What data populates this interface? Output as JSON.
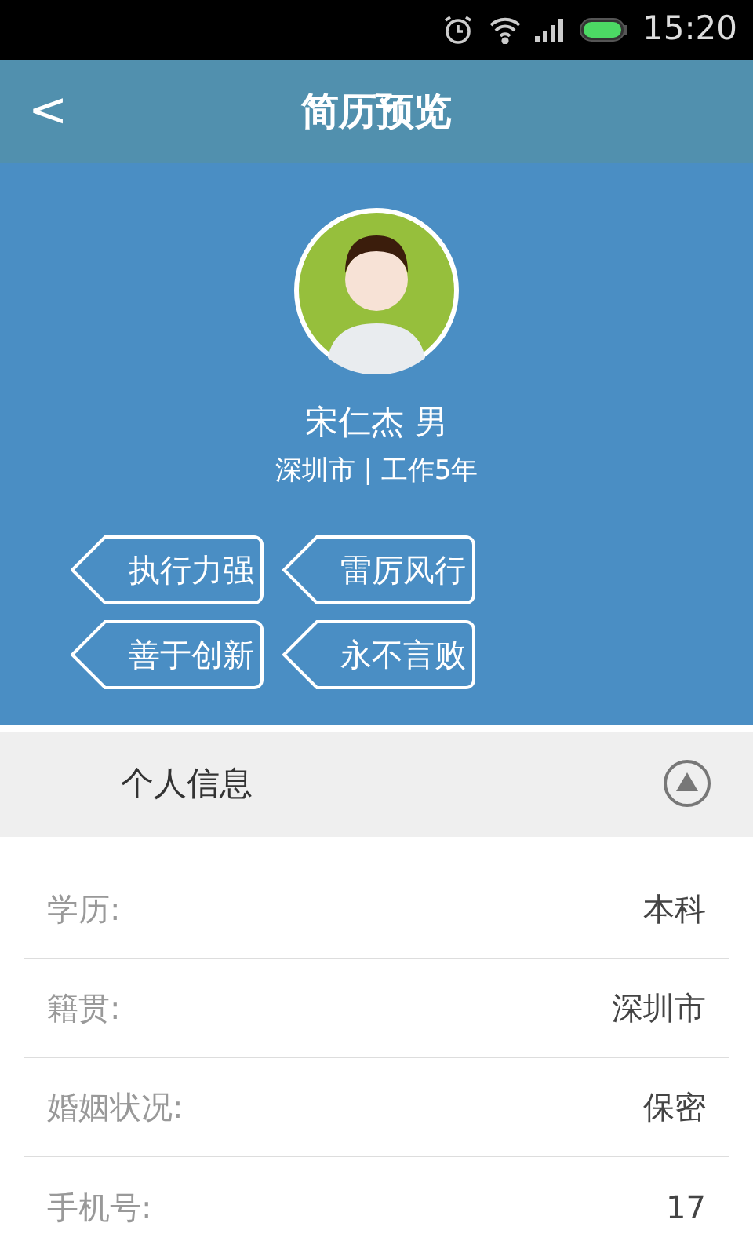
{
  "status_bar": {
    "time": "15:20"
  },
  "header": {
    "back": "<",
    "title": "简历预览"
  },
  "profile": {
    "name": "宋仁杰 男",
    "subtitle": "深圳市 | 工作5年",
    "tags": [
      "执行力强",
      "雷厉风行",
      "善于创新",
      "永不言败"
    ]
  },
  "section": {
    "title": "个人信息",
    "expanded": true
  },
  "fields": [
    {
      "label": "学历:",
      "value": "本科"
    },
    {
      "label": "籍贯:",
      "value": "深圳市"
    },
    {
      "label": "婚姻状况:",
      "value": "保密"
    },
    {
      "label": "手机号:",
      "value": "17"
    }
  ]
}
